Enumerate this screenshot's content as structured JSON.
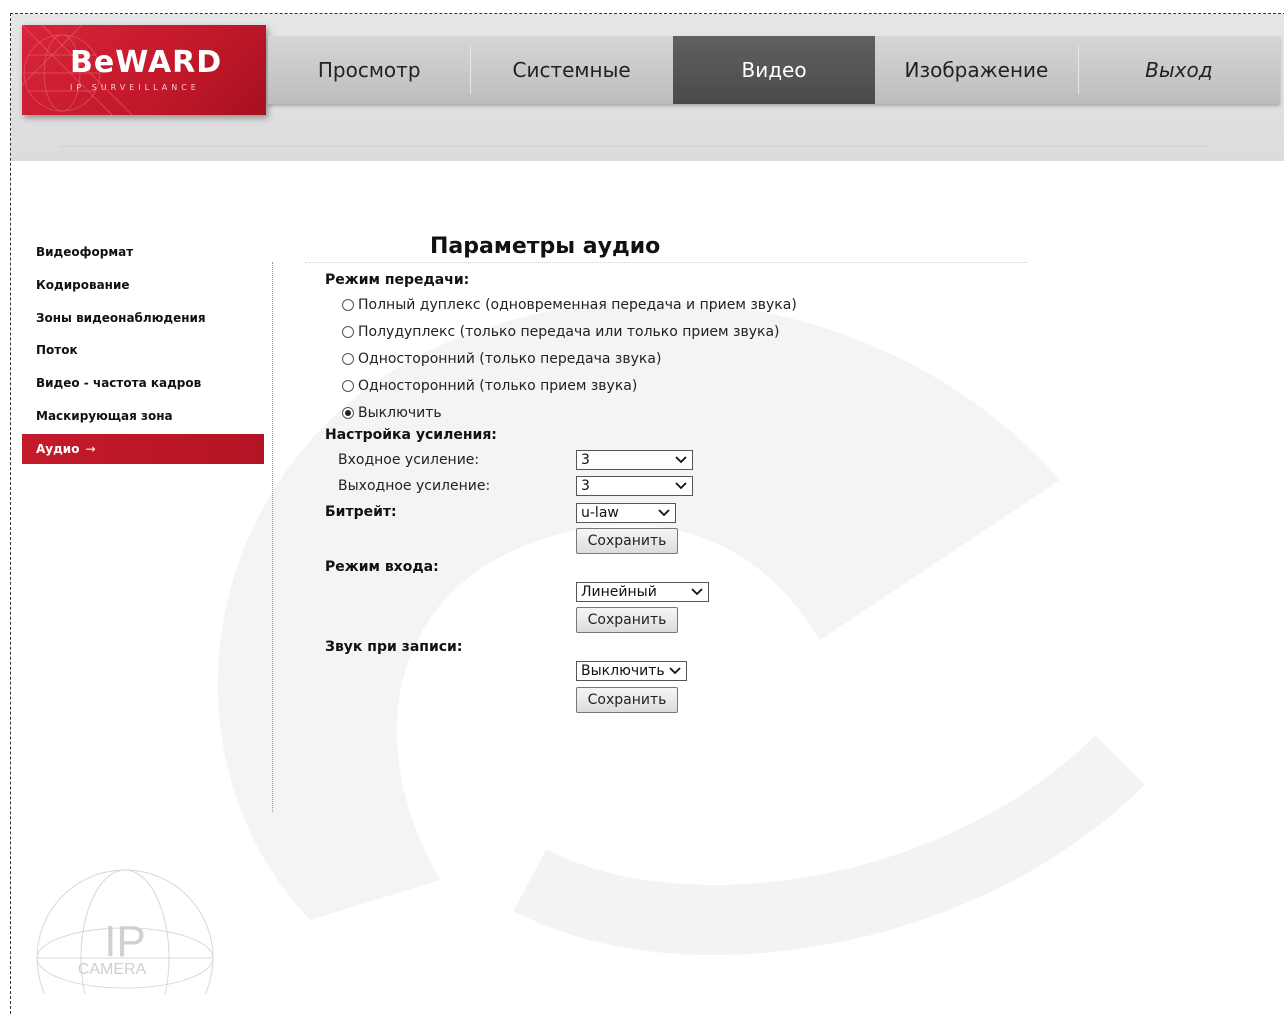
{
  "brand": {
    "name": "BeWARD",
    "tagline": "IP SURVEILLANCE"
  },
  "topnav": {
    "tabs": [
      {
        "label": "Просмотр",
        "active": false
      },
      {
        "label": "Системные",
        "active": false
      },
      {
        "label": "Видео",
        "active": true
      },
      {
        "label": "Изображение",
        "active": false
      },
      {
        "label": "Выход",
        "active": false
      }
    ]
  },
  "sidebar": {
    "items": [
      {
        "label": "Видеоформат",
        "active": false
      },
      {
        "label": "Кодирование",
        "active": false
      },
      {
        "label": "Зоны видеонаблюдения",
        "active": false
      },
      {
        "label": "Поток",
        "active": false
      },
      {
        "label": "Видео - частота кадров",
        "active": false
      },
      {
        "label": "Маскирующая зона",
        "active": false
      },
      {
        "label": "Аудио",
        "active": true
      }
    ],
    "active_arrow": "→"
  },
  "main": {
    "title": "Параметры аудио",
    "transfer_mode": {
      "label": "Режим передачи:",
      "options": [
        {
          "label": "Полный дуплекс (одновременная передача и прием звука)",
          "checked": false
        },
        {
          "label": "Полудуплекс (только передача или только прием звука)",
          "checked": false
        },
        {
          "label": "Односторонний (только передача звука)",
          "checked": false
        },
        {
          "label": "Односторонний (только прием звука)",
          "checked": false
        },
        {
          "label": "Выключить",
          "checked": true
        }
      ]
    },
    "gain": {
      "label": "Настройка усиления:",
      "input_label": "Входное усиление:",
      "input_value": "3",
      "output_label": "Выходное усиление:",
      "output_value": "3"
    },
    "bitrate": {
      "label": "Битрейт:",
      "value": "u-law",
      "save_label": "Сохранить"
    },
    "input_mode": {
      "label": "Режим входа:",
      "value": "Линейный",
      "save_label": "Сохранить"
    },
    "record_sound": {
      "label": "Звук при записи:",
      "value": "Выключить",
      "save_label": "Сохранить"
    }
  },
  "footer_logo": {
    "line1": "IP",
    "line2": "CAMERA"
  },
  "colors": {
    "brand_red": "#c51a2b",
    "nav_active": "#545454",
    "nav_bg": "#c9c9c9"
  }
}
